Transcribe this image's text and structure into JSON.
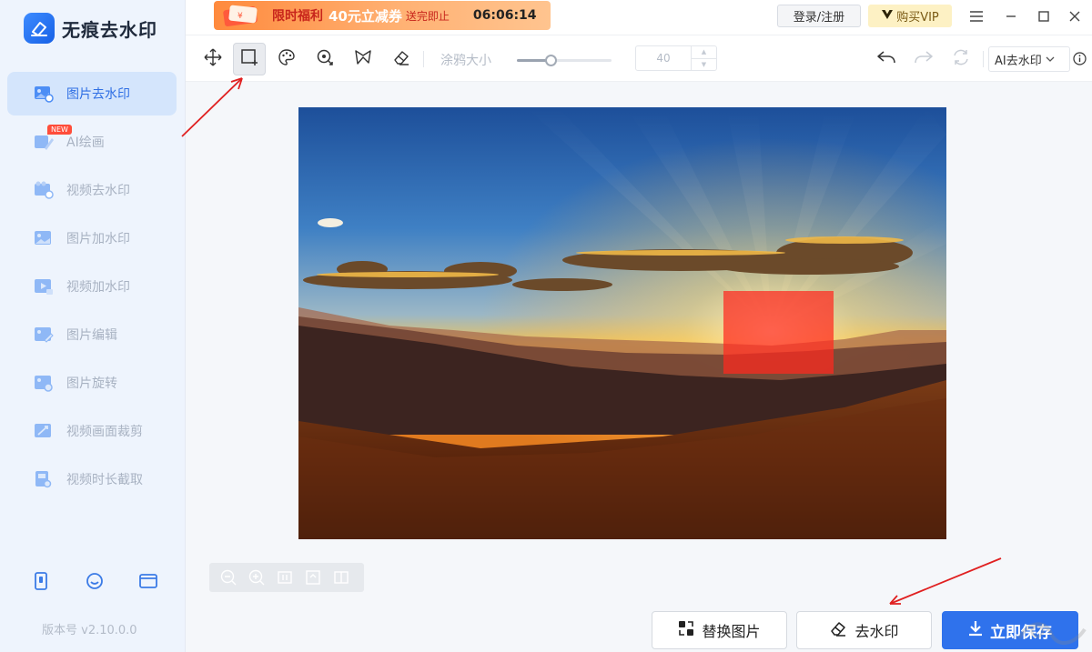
{
  "app": {
    "name": "无痕去水印",
    "version": "版本号 v2.10.0.0"
  },
  "sidebar": {
    "items": [
      {
        "label": "图片去水印",
        "icon": "image-watermark-icon",
        "active": true
      },
      {
        "label": "AI绘画",
        "icon": "ai-paint-icon",
        "badge": "NEW"
      },
      {
        "label": "视频去水印",
        "icon": "video-watermark-icon"
      },
      {
        "label": "图片加水印",
        "icon": "image-add-watermark-icon"
      },
      {
        "label": "视频加水印",
        "icon": "video-add-watermark-icon"
      },
      {
        "label": "图片编辑",
        "icon": "image-edit-icon"
      },
      {
        "label": "图片旋转",
        "icon": "image-rotate-icon"
      },
      {
        "label": "视频画面裁剪",
        "icon": "video-crop-icon"
      },
      {
        "label": "视频时长截取",
        "icon": "video-trim-icon"
      }
    ],
    "bottom_icons": [
      "phone-icon",
      "smiley-icon",
      "window-icon"
    ]
  },
  "topbar": {
    "promo": {
      "title": "限时福利",
      "amount": "40元立减券",
      "note": "送完即止",
      "countdown": "06:06:14"
    },
    "login_label": "登录/注册",
    "vip_label": "购买VIP",
    "window_controls": [
      "menu-icon",
      "minimize-icon",
      "maximize-icon",
      "close-icon"
    ]
  },
  "toolbar": {
    "tools": [
      "move-icon",
      "rect-select-icon",
      "palette-icon",
      "smart-select-icon",
      "lasso-icon",
      "eraser-icon"
    ],
    "active_tool": "rect-select-icon",
    "brush_label": "涂鸦大小",
    "brush_size": 40,
    "brush_slider_fraction": 0.36,
    "mode_label": "AI去水印"
  },
  "actions": {
    "replace_label": "替换图片",
    "remove_label": "去水印",
    "save_label": "立即保存"
  },
  "colors": {
    "accent": "#2f72ec",
    "selection": "#ff281e",
    "promo": "#ff8a3d",
    "annotation": "#e02020"
  }
}
